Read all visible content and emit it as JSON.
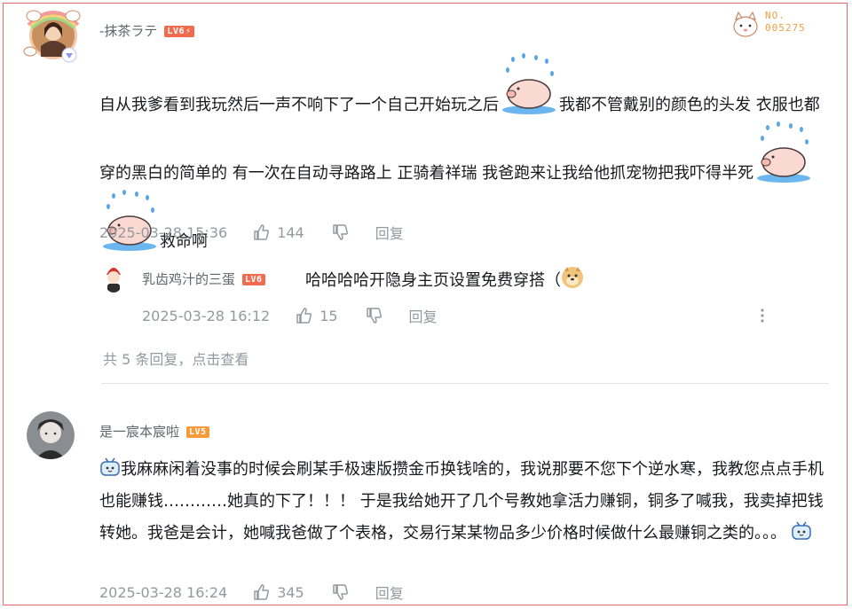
{
  "comment1": {
    "user": {
      "name": "-抹茶ラテ",
      "level": "LV6"
    },
    "fan_card": {
      "label": "NO.",
      "number": "005275"
    },
    "text_part1": "自从我爹看到我玩然后一声不响下了一个自己开始玩之后",
    "text_part2": "我都不管戴别的颜色的头发 衣服也都穿的黑白的简单的 有一次在自动寻路路上 正骑着祥瑞 我爸跑来让我给他抓宠物把我吓得半死",
    "text_part3": "救命啊",
    "time": "2025-03-28 15:36",
    "likes": "144",
    "reply_label": "回复",
    "sticker_name": "sweating-pig-sticker"
  },
  "reply1": {
    "user": {
      "name": "乳齿鸡汁的三蛋",
      "level": "LV6"
    },
    "text": "哈哈哈哈开隐身主页设置免费穿搭（",
    "time": "2025-03-28 16:12",
    "likes": "15",
    "reply_label": "回复",
    "more_label": "⋮"
  },
  "view_more": "共 5 条回复，点击查看",
  "comment2": {
    "user": {
      "name": "是一宸本宸啦",
      "level": "LV5"
    },
    "text": "我麻麻闲着没事的时候会刷某手极速版攒金币换钱啥的，我说那要不您下个逆水寒，我教您点点手机也能赚钱…………她真的下了！！！ 于是我给她开了几个号教她拿活力赚铜，铜多了喊我，我卖掉把钱转她。我爸是会计，她喊我爸做了个表格，交易行某某物品多少价格时候做什么最赚铜之类的。。。",
    "time": "2025-03-28 16:24",
    "likes": "345",
    "reply_label": "回复"
  },
  "colors": {
    "accent_level6": "#f26b4f",
    "accent_level5": "#f69a3a",
    "meta_gray": "#9499a0",
    "border": "#e46a6a"
  }
}
